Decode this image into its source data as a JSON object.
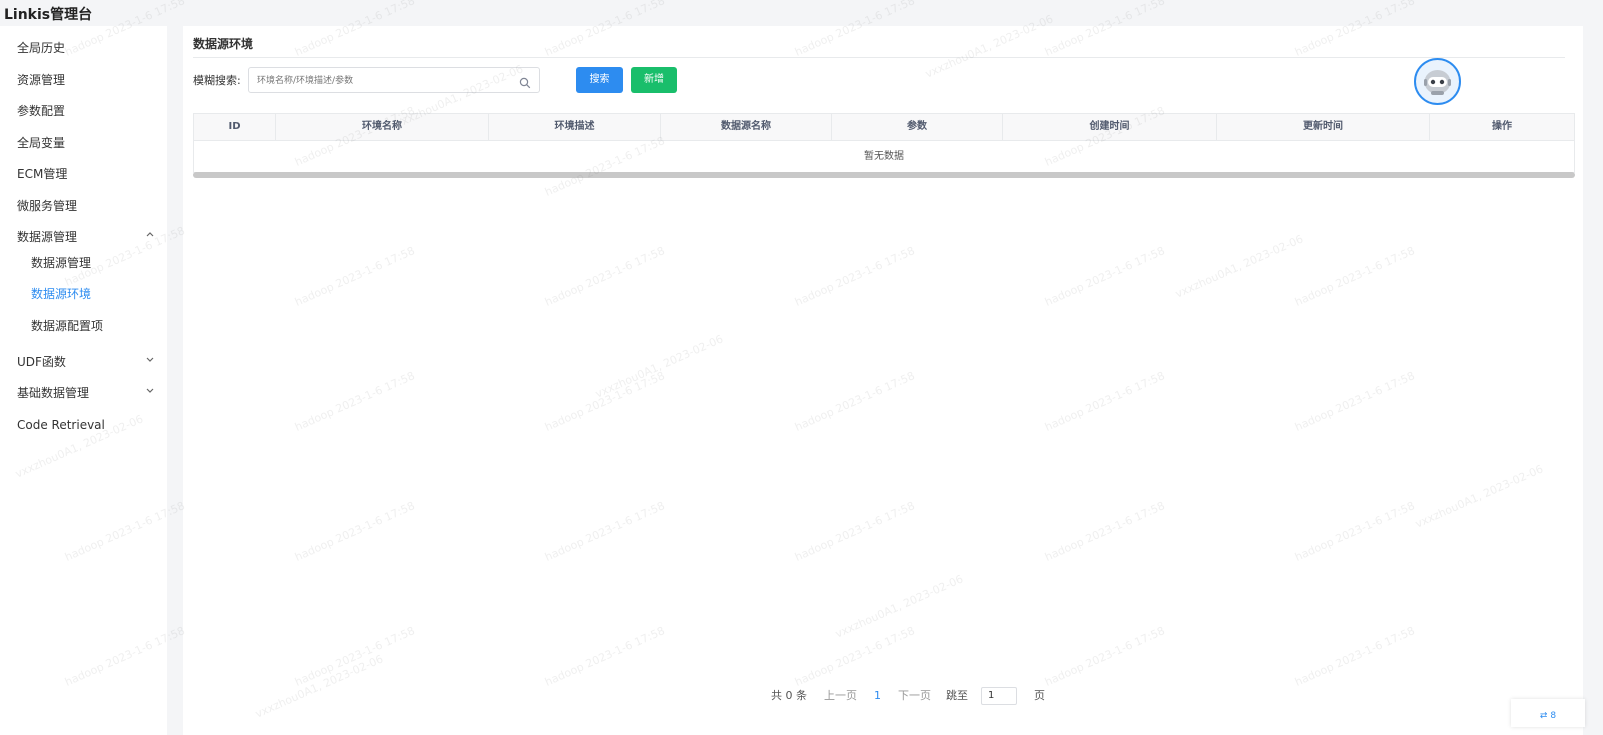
{
  "app": {
    "title": "Linkis管理台"
  },
  "sidebar": {
    "items": [
      {
        "label": "全局历史"
      },
      {
        "label": "资源管理"
      },
      {
        "label": "参数配置"
      },
      {
        "label": "全局变量"
      },
      {
        "label": "ECM管理"
      },
      {
        "label": "微服务管理"
      },
      {
        "label": "数据源管理",
        "expanded": true
      },
      {
        "label": "数据源管理",
        "sub": true
      },
      {
        "label": "数据源环境",
        "sub": true,
        "active": true
      },
      {
        "label": "数据源配置项",
        "sub": true
      },
      {
        "label": "UDF函数",
        "expanded": false
      },
      {
        "label": "基础数据管理",
        "expanded": false
      },
      {
        "label": "Code Retrieval"
      }
    ]
  },
  "main": {
    "page_title": "数据源环境",
    "search": {
      "label": "模糊搜索:",
      "placeholder": "环境名称/环境描述/参数",
      "value": ""
    },
    "buttons": {
      "search": "搜索",
      "add": "新增"
    },
    "table": {
      "columns": [
        "ID",
        "环境名称",
        "环境描述",
        "数据源名称",
        "参数",
        "创建时间",
        "更新时间",
        "操作"
      ],
      "rows": [],
      "empty_text": "暂无数据"
    },
    "pagination": {
      "total": "共 0 条",
      "prev": "上一页",
      "current": "1",
      "next": "下一页",
      "jump_label": "跳至",
      "jump_value": "1",
      "page_unit": "页"
    }
  },
  "watermark": {
    "line1": "hadoop 2023-1-6 17:58",
    "line2": "vxxzhou0A1, 2023-02-06"
  },
  "corner_widget": {
    "label": "8"
  },
  "colors": {
    "primary": "#2d8cf0",
    "success": "#19be6b",
    "sidebar_active": "#2d8cf0"
  },
  "icons": {
    "search": "search-icon",
    "chevron_up": "chevron-up-icon",
    "chevron_down": "chevron-down-icon",
    "avatar": "robot-avatar-icon"
  }
}
